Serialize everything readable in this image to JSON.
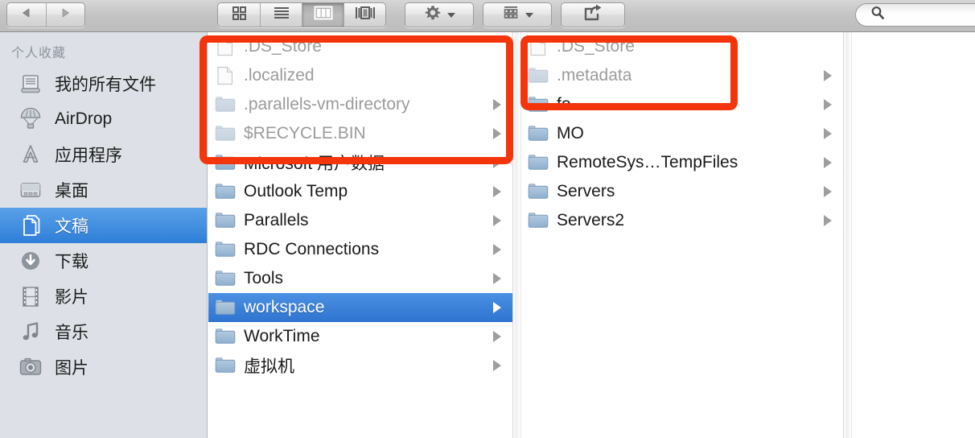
{
  "toolbar": {
    "nav": [
      {
        "name": "back-button",
        "icon": "chevron-left-icon",
        "label": "Back"
      },
      {
        "name": "forward-button",
        "icon": "chevron-right-icon",
        "label": "Forward"
      }
    ],
    "view_modes": [
      {
        "name": "icon-view-button",
        "icon": "grid-icon",
        "label": "Icon View",
        "active": false
      },
      {
        "name": "list-view-button",
        "icon": "list-icon",
        "label": "List View",
        "active": false
      },
      {
        "name": "column-view-button",
        "icon": "columns-icon",
        "label": "Column View",
        "active": true
      },
      {
        "name": "coverflow-view-button",
        "icon": "coverflow-icon",
        "label": "Cover Flow View",
        "active": false
      }
    ],
    "action_menu": {
      "icon": "gear-icon",
      "label": "Action",
      "has_dropdown": true
    },
    "arrange_menu": {
      "icon": "arrange-grid-icon",
      "label": "Arrange",
      "has_dropdown": true
    },
    "share_button": {
      "icon": "share-icon",
      "label": "Share"
    },
    "search": {
      "icon": "search-icon",
      "placeholder": "",
      "value": ""
    }
  },
  "sidebar": {
    "header": "个人收藏",
    "items": [
      {
        "label": "我的所有文件",
        "icon": "all-my-files-icon",
        "name": "sidebar-item-all-my-files",
        "selected": false
      },
      {
        "label": "AirDrop",
        "icon": "airdrop-icon",
        "name": "sidebar-item-airdrop",
        "selected": false
      },
      {
        "label": "应用程序",
        "icon": "applications-icon",
        "name": "sidebar-item-applications",
        "selected": false
      },
      {
        "label": "桌面",
        "icon": "desktop-icon",
        "name": "sidebar-item-desktop",
        "selected": false
      },
      {
        "label": "文稿",
        "icon": "documents-icon",
        "name": "sidebar-item-documents",
        "selected": true
      },
      {
        "label": "下载",
        "icon": "downloads-icon",
        "name": "sidebar-item-downloads",
        "selected": false
      },
      {
        "label": "影片",
        "icon": "movies-icon",
        "name": "sidebar-item-movies",
        "selected": false
      },
      {
        "label": "音乐",
        "icon": "music-icon",
        "name": "sidebar-item-music",
        "selected": false
      },
      {
        "label": "图片",
        "icon": "pictures-icon",
        "name": "sidebar-item-pictures",
        "selected": false
      }
    ]
  },
  "columns": [
    {
      "name": "file-column-1",
      "rows": [
        {
          "label": ".DS_Store",
          "icon": "file-icon",
          "dimmed": true,
          "arrow": false,
          "selected": false
        },
        {
          "label": ".localized",
          "icon": "file-icon",
          "dimmed": true,
          "arrow": false,
          "selected": false
        },
        {
          "label": ".parallels-vm-directory",
          "icon": "folder-icon",
          "dimmed": true,
          "arrow": true,
          "selected": false
        },
        {
          "label": "$RECYCLE.BIN",
          "icon": "folder-icon",
          "dimmed": true,
          "arrow": true,
          "selected": false
        },
        {
          "label": "Microsoft 用户数据",
          "icon": "folder-icon",
          "dimmed": false,
          "arrow": true,
          "selected": false
        },
        {
          "label": "Outlook Temp",
          "icon": "folder-icon",
          "dimmed": false,
          "arrow": true,
          "selected": false
        },
        {
          "label": "Parallels",
          "icon": "folder-icon",
          "dimmed": false,
          "arrow": true,
          "selected": false
        },
        {
          "label": "RDC Connections",
          "icon": "folder-icon",
          "dimmed": false,
          "arrow": true,
          "selected": false
        },
        {
          "label": "Tools",
          "icon": "folder-icon",
          "dimmed": false,
          "arrow": true,
          "selected": false
        },
        {
          "label": "workspace",
          "icon": "folder-icon",
          "dimmed": false,
          "arrow": true,
          "selected": true
        },
        {
          "label": "WorkTime",
          "icon": "folder-icon",
          "dimmed": false,
          "arrow": true,
          "selected": false
        },
        {
          "label": "虚拟机",
          "icon": "folder-icon",
          "dimmed": false,
          "arrow": true,
          "selected": false
        }
      ]
    },
    {
      "name": "file-column-2",
      "rows": [
        {
          "label": ".DS_Store",
          "icon": "file-icon",
          "dimmed": true,
          "arrow": false,
          "selected": false
        },
        {
          "label": ".metadata",
          "icon": "folder-icon",
          "dimmed": true,
          "arrow": true,
          "selected": false
        },
        {
          "label": "fo",
          "icon": "folder-icon",
          "dimmed": false,
          "arrow": true,
          "selected": false
        },
        {
          "label": "MO",
          "icon": "folder-icon",
          "dimmed": false,
          "arrow": true,
          "selected": false
        },
        {
          "label": "RemoteSys…TempFiles",
          "icon": "folder-icon",
          "dimmed": false,
          "arrow": true,
          "selected": false
        },
        {
          "label": "Servers",
          "icon": "folder-icon",
          "dimmed": false,
          "arrow": true,
          "selected": false
        },
        {
          "label": "Servers2",
          "icon": "folder-icon",
          "dimmed": false,
          "arrow": true,
          "selected": false
        }
      ]
    },
    {
      "name": "file-column-3",
      "rows": []
    }
  ],
  "annotations": [
    {
      "name": "highlight-box-hidden-files-column-1",
      "color": "#f4350c"
    },
    {
      "name": "highlight-box-hidden-files-column-2",
      "color": "#f4350c"
    }
  ]
}
